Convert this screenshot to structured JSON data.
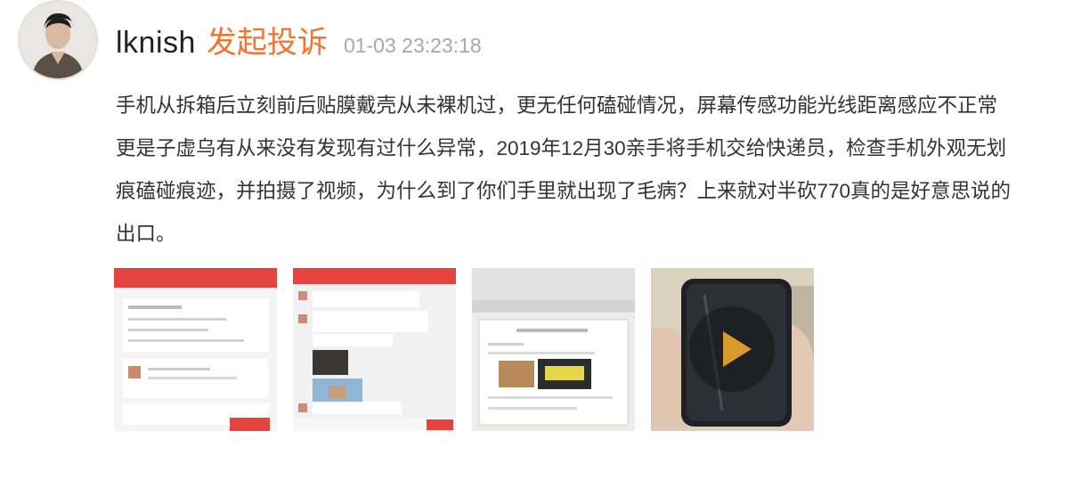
{
  "post": {
    "username": "lknish",
    "complaint_label": "发起投诉",
    "timestamp": "01-03 23:23:18",
    "text": "手机从拆箱后立刻前后贴膜戴壳从未裸机过，更无任何磕碰情况，屏幕传感功能光线距离感应不正常更是子虚乌有从来没有发现有过什么异常，2019年12月30亲手将手机交给快递员，检查手机外观无划痕磕碰痕迹，并拍摄了视频，为什么到了你们手里就出现了毛病？上来就对半砍770真的是好意思说的出口。"
  },
  "colors": {
    "complaint": "#f4732f",
    "timestamp": "#a8a8a8",
    "app_red": "#e64340",
    "play_triangle": "#d79a2b"
  },
  "attachments": [
    {
      "kind": "screenshot",
      "icon": "app-screenshot"
    },
    {
      "kind": "screenshot",
      "icon": "chat-screenshot"
    },
    {
      "kind": "screenshot",
      "icon": "document-screenshot"
    },
    {
      "kind": "video",
      "icon": "play-icon"
    }
  ]
}
